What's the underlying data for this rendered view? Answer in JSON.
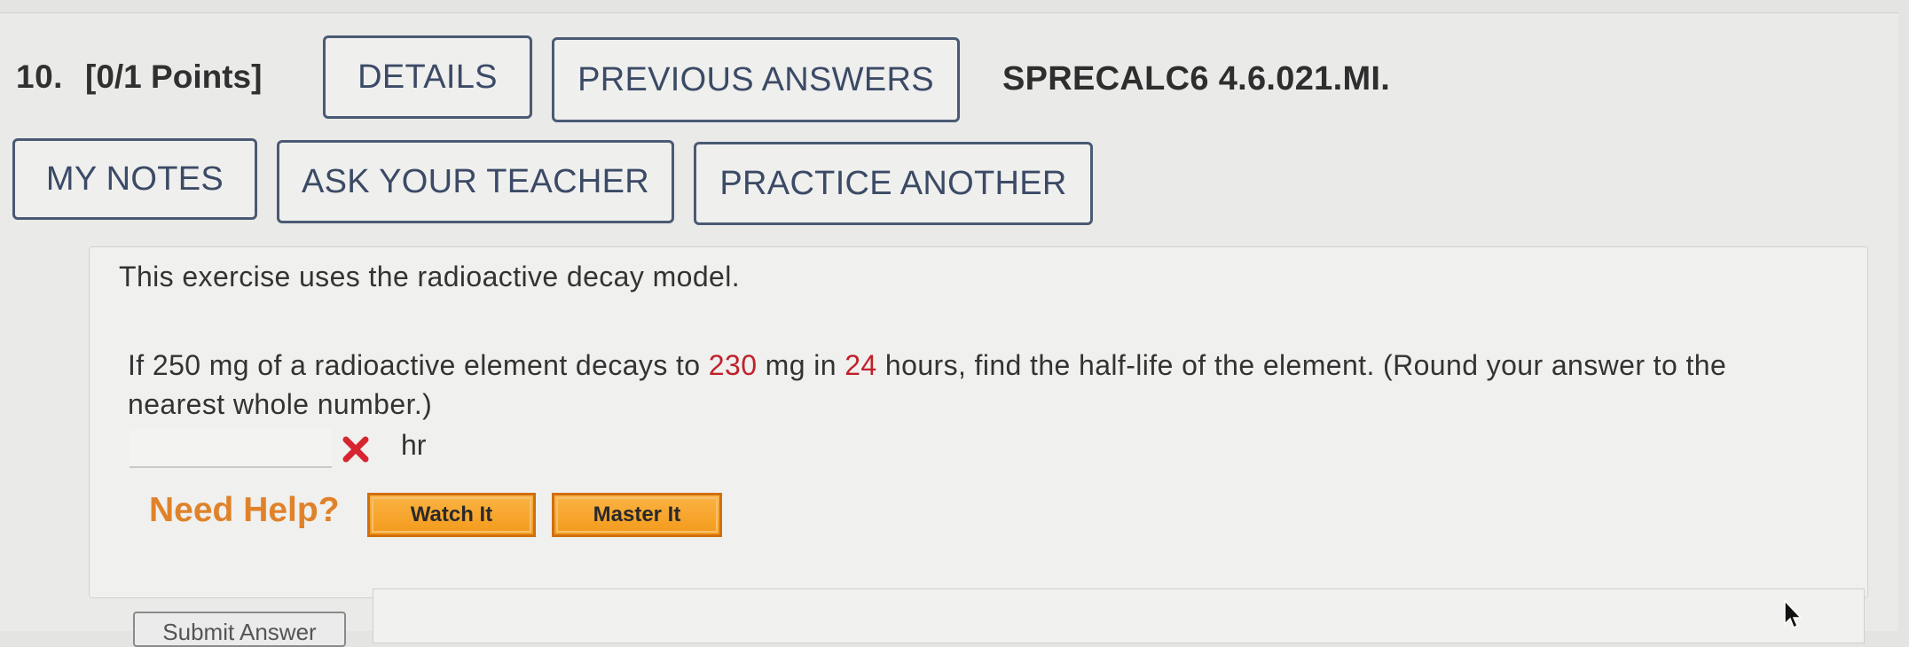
{
  "question": {
    "number": "10.",
    "points": "[0/1 Points]",
    "source": "SPRECALC6 4.6.021.MI."
  },
  "toolbar": {
    "details": "DETAILS",
    "previous_answers": "PREVIOUS ANSWERS",
    "my_notes": "MY NOTES",
    "ask_teacher": "ASK YOUR TEACHER",
    "practice_another": "PRACTICE ANOTHER"
  },
  "problem": {
    "intro": "This exercise uses the radioactive decay model.",
    "text_1": "If 250 mg of a radioactive element decays to ",
    "value_mass": "230",
    "text_2": " mg in ",
    "value_time": "24",
    "text_3": " hours, find the half-life of the element. (Round your answer to the nearest whole number.)"
  },
  "answer": {
    "value": "",
    "unit": "hr",
    "status_icon": "incorrect-x-icon",
    "status_color": "#d6262f"
  },
  "help": {
    "label": "Need Help?",
    "watch_it": "Watch It",
    "master_it": "Master It"
  },
  "submit": {
    "label": "Submit Answer"
  },
  "colors": {
    "accent_text": "#c0212b",
    "button_border": "#4a5a74",
    "help_orange": "#f39a1b"
  }
}
